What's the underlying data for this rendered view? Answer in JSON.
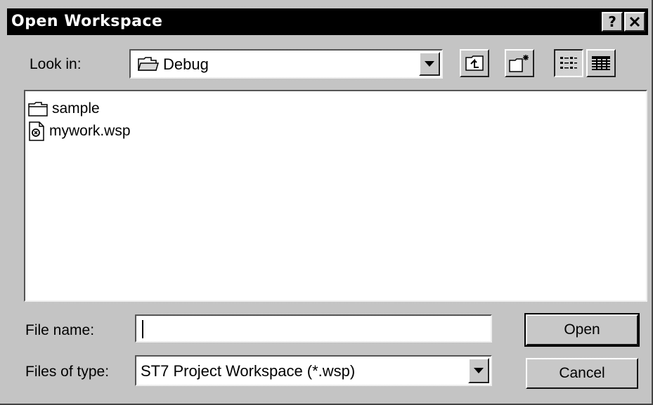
{
  "dialog": {
    "title": "Open Workspace",
    "help_label": "?",
    "close_label": "✕"
  },
  "look_in": {
    "label": "Look in:",
    "value": "Debug"
  },
  "files": [
    {
      "name": "sample",
      "icon": "folder-icon"
    },
    {
      "name": "mywork.wsp",
      "icon": "workspace-file-icon"
    }
  ],
  "file_name": {
    "label": "File name:",
    "value": ""
  },
  "files_of_type": {
    "label": "Files of type:",
    "value": "ST7 Project Workspace (*.wsp)"
  },
  "buttons": {
    "open": "Open",
    "cancel": "Cancel"
  }
}
